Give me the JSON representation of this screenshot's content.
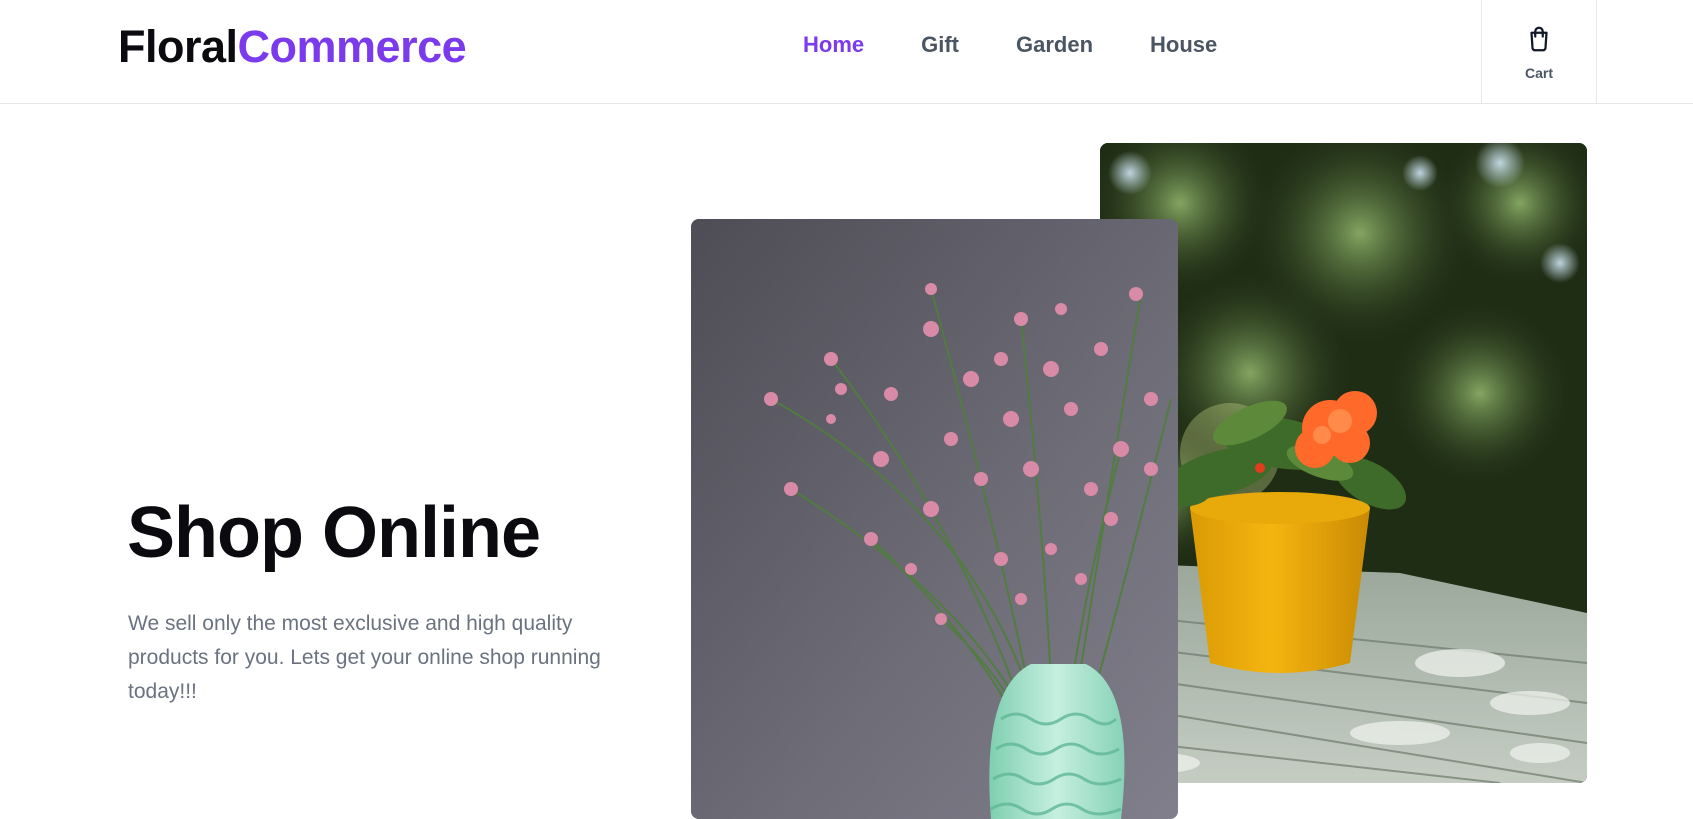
{
  "header": {
    "logo": {
      "part_a": "Floral",
      "part_b": "Commerce"
    },
    "nav": [
      {
        "label": "Home",
        "active": true
      },
      {
        "label": "Gift",
        "active": false
      },
      {
        "label": "Garden",
        "active": false
      },
      {
        "label": "House",
        "active": false
      }
    ],
    "cart": {
      "label": "Cart",
      "icon": "shopping-bag-icon"
    }
  },
  "hero": {
    "title": "Shop Online",
    "description": "We sell only the most exclusive and high quality products for you. Lets get your online shop running today!!!"
  },
  "images": {
    "left": "pink-flowers-vase-image",
    "right": "orange-flower-pot-image"
  },
  "colors": {
    "accent": "#7c3aed",
    "text_dark": "#0b0b0f",
    "text_muted": "#6b7280",
    "nav_text": "#4b5563",
    "border": "#e5e7eb"
  }
}
